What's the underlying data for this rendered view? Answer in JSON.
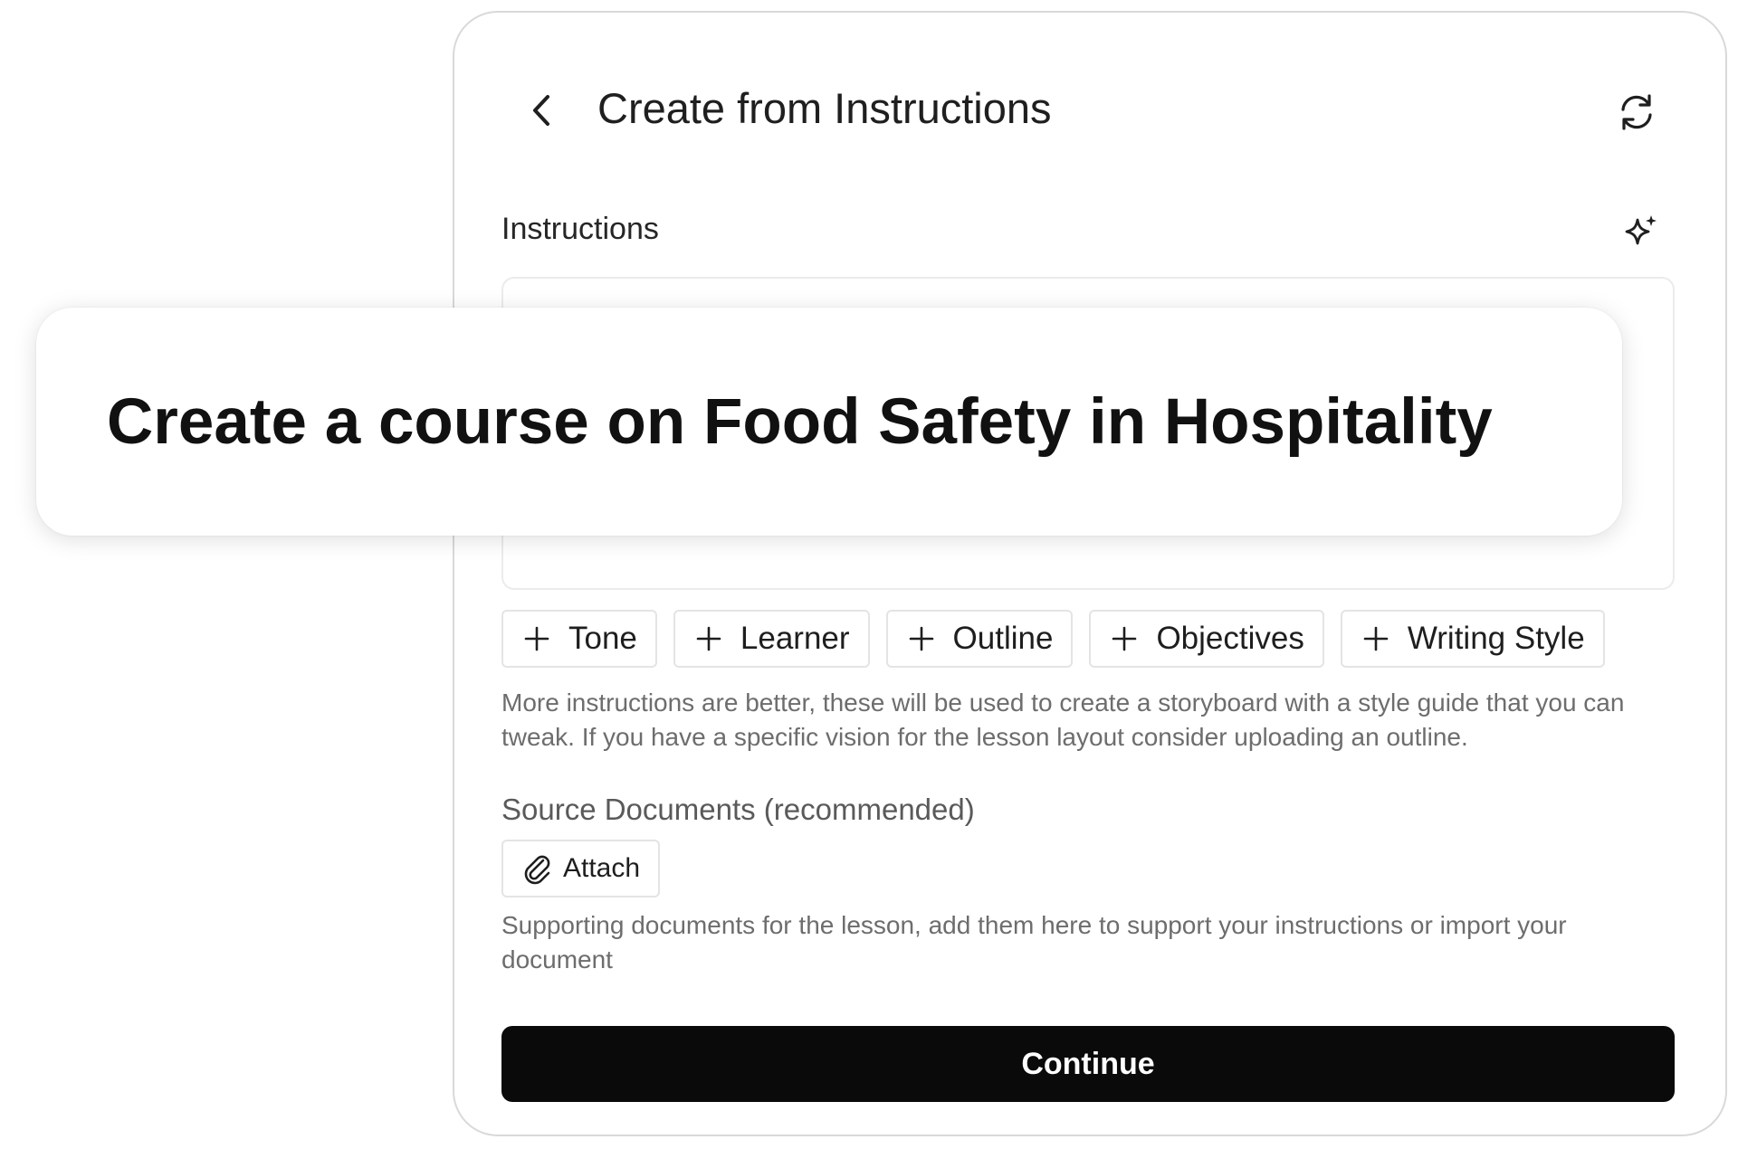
{
  "header": {
    "title": "Create from Instructions",
    "back_icon": "chevron-left-icon",
    "refresh_icon": "refresh-icon"
  },
  "instructions": {
    "label": "Instructions",
    "sparkle_icon": "sparkle-icon",
    "value": "Create a course on Food Safety in Hospitality"
  },
  "chips": [
    {
      "label": "Tone",
      "icon": "plus-icon"
    },
    {
      "label": "Learner",
      "icon": "plus-icon"
    },
    {
      "label": "Outline",
      "icon": "plus-icon"
    },
    {
      "label": "Objectives",
      "icon": "plus-icon"
    },
    {
      "label": "Writing Style",
      "icon": "plus-icon"
    }
  ],
  "instructions_help": "More instructions are better, these will be used to create a storyboard with a style guide that you can tweak. If you have a specific vision for the lesson layout consider uploading an outline.",
  "source_documents": {
    "label": "Source Documents (recommended)",
    "attach_label": "Attach",
    "attach_icon": "paperclip-icon",
    "help": "Supporting documents for the lesson, add them here to support your instructions or import your document"
  },
  "actions": {
    "continue_label": "Continue"
  },
  "colors": {
    "primary_button": "#0a0a0a",
    "muted_text": "#6d6d6d",
    "border": "#e4e4e4"
  }
}
